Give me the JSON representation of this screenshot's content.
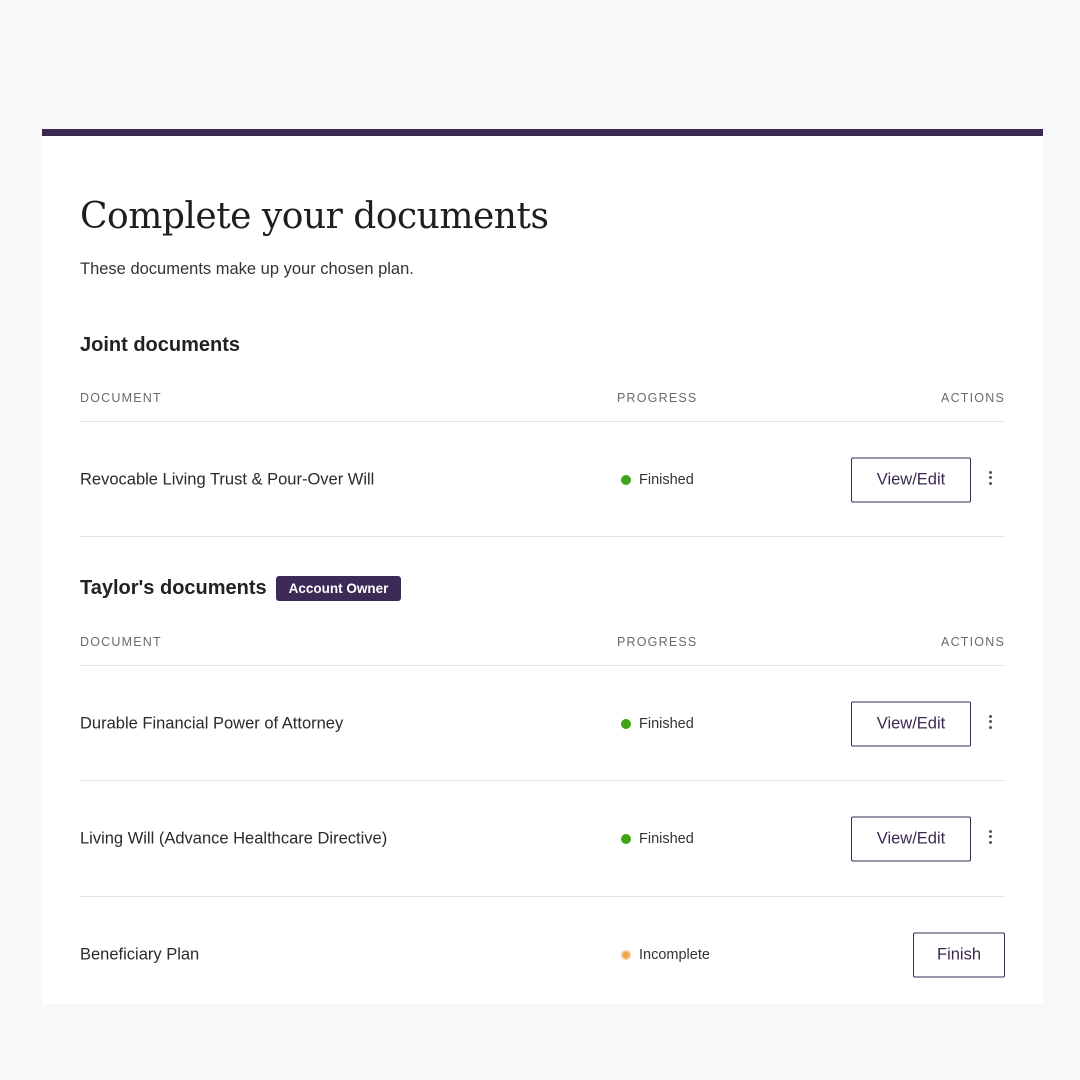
{
  "page": {
    "title": "Complete your documents",
    "subtitle": "These documents make up your chosen plan."
  },
  "columns": {
    "document": "DOCUMENT",
    "progress": "PROGRESS",
    "actions": "ACTIONS"
  },
  "sections": [
    {
      "title": "Joint documents",
      "badge": "",
      "rows": [
        {
          "name": "Revocable Living Trust & Pour-Over Will",
          "status": "Finished",
          "status_color": "#3fa312",
          "action": "View/Edit",
          "has_menu": true
        }
      ]
    },
    {
      "title": "Taylor's documents",
      "badge": "Account Owner",
      "rows": [
        {
          "name": "Durable Financial Power of Attorney",
          "status": "Finished",
          "status_color": "#3fa312",
          "action": "View/Edit",
          "has_menu": true
        },
        {
          "name": "Living Will (Advance Healthcare Directive)",
          "status": "Finished",
          "status_color": "#3fa312",
          "action": "View/Edit",
          "has_menu": true
        },
        {
          "name": "Beneficiary Plan",
          "status": "Incomplete",
          "status_color": "#f2a14a",
          "action": "Finish",
          "has_menu": false
        }
      ]
    }
  ],
  "colors": {
    "accent": "#3a2a50",
    "badge_bg": "#3d2a56",
    "finished": "#3fa312",
    "incomplete": "#f2a14a"
  }
}
